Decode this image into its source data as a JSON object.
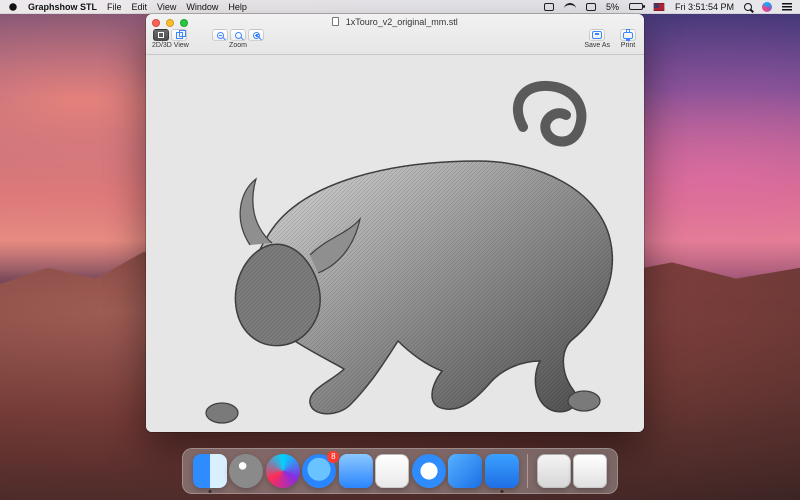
{
  "menubar": {
    "app_name": "Graphshow STL",
    "menus": [
      "File",
      "Edit",
      "View",
      "Window",
      "Help"
    ],
    "battery_percent": "5%",
    "clock": "Fri 3:51:54 PM"
  },
  "window": {
    "title": "1xTouro_v2_original_mm.stl",
    "toolbar": {
      "view_label": "2D/3D View",
      "zoom_label": "Zoom",
      "save_label": "Save As",
      "print_label": "Print"
    }
  },
  "dock": {
    "appstore_badge": "8"
  },
  "colors": {
    "accent_blue": "#3c86ff",
    "close": "#ff5f57",
    "minimize": "#ffbd2e",
    "zoom": "#28c840"
  },
  "icons": {
    "menubar": [
      "apple-icon",
      "status-icon",
      "wifi-icon",
      "battery-icon",
      "flag-icon",
      "search-icon",
      "siri-icon",
      "list-icon"
    ],
    "toolbar": [
      "2d-view-icon",
      "3d-view-icon",
      "zoom-out-icon",
      "zoom-in-icon",
      "zoom-plus-icon",
      "save-icon",
      "print-icon"
    ],
    "dock": [
      "finder-icon",
      "launchpad-icon",
      "siri-icon",
      "app-store-icon",
      "preview-icon",
      "textedit-icon",
      "safari-icon",
      "xcode-icon",
      "graphshow-stl-icon",
      "image-folder-icon",
      "trash-icon"
    ]
  }
}
